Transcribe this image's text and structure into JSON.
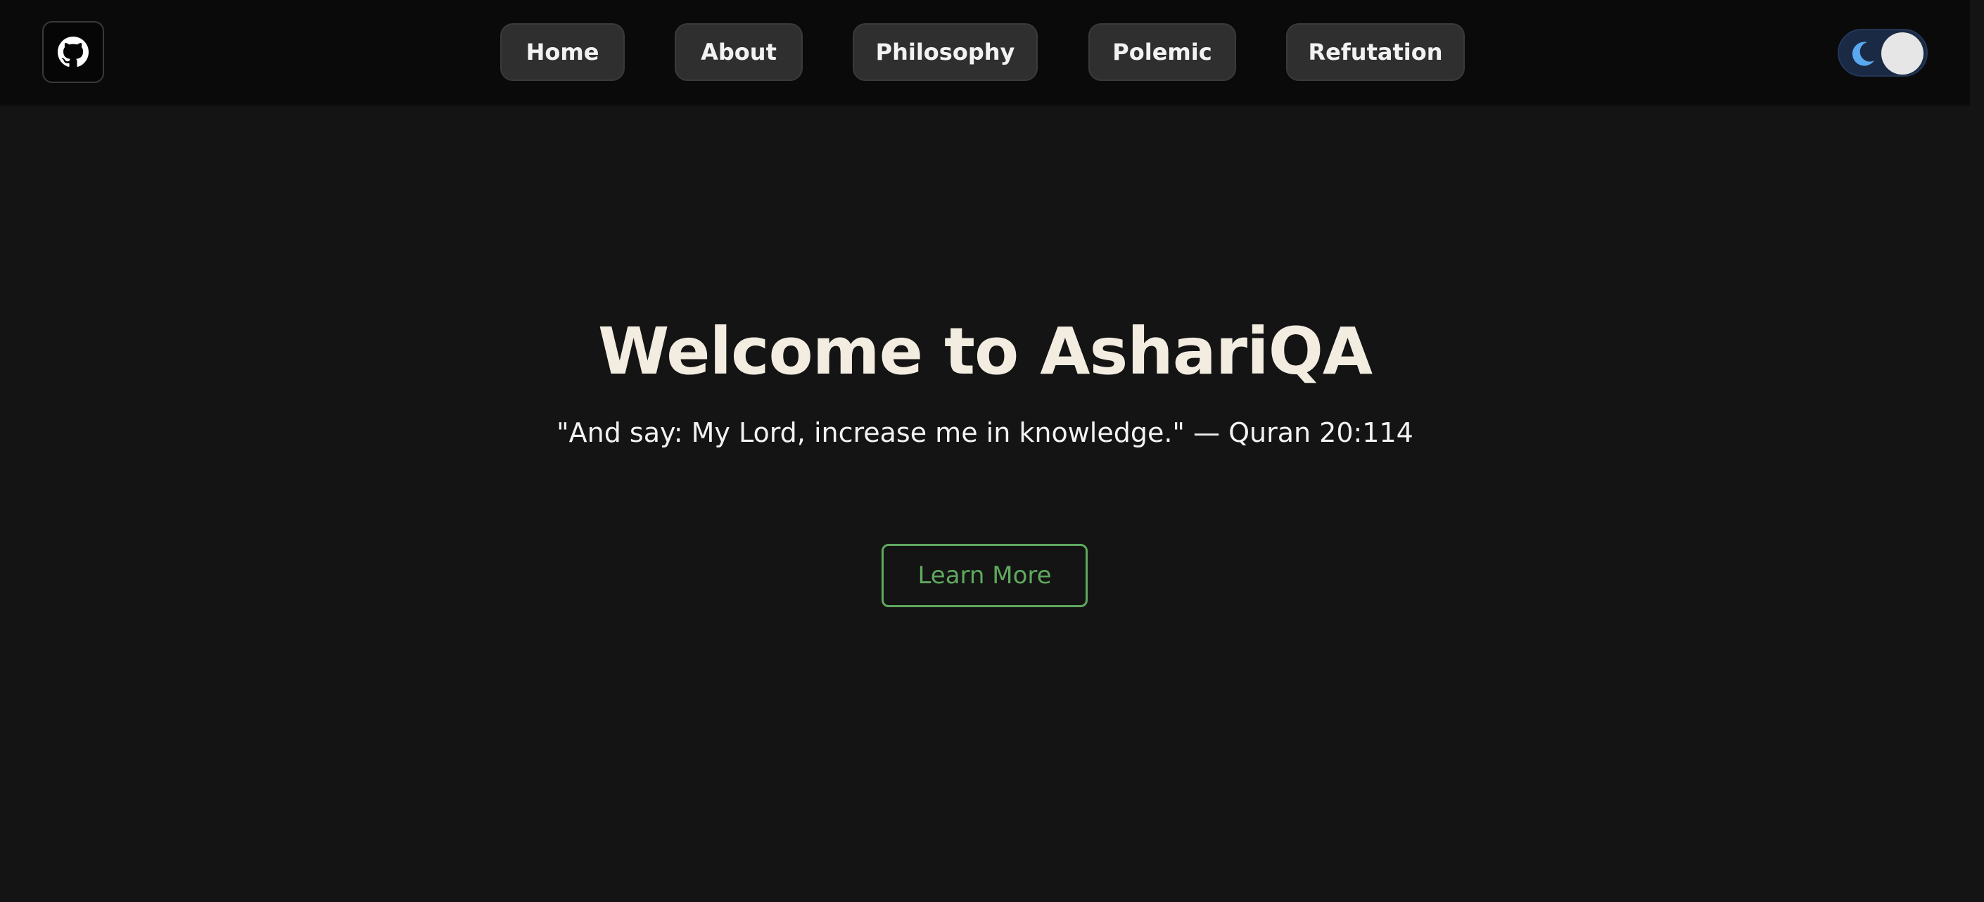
{
  "header": {
    "github_icon": "github-icon",
    "nav": {
      "home": "Home",
      "about": "About",
      "philosophy": "Philosophy",
      "polemic": "Polemic",
      "refutation": "Refutation"
    },
    "theme_toggle": {
      "icon": "moon-icon",
      "mode": "dark",
      "track_color": "#1a2a44",
      "moon_color": "#5aa8f0"
    }
  },
  "hero": {
    "title": "Welcome to AshariQA",
    "quote": "\"And say: My Lord, increase me in knowledge.\" — Quran 20:114",
    "cta_label": "Learn More",
    "cta_color": "#5fa85f"
  },
  "colors": {
    "background": "#141414",
    "navbar": "#0a0a0a",
    "title": "#f3ede1"
  }
}
